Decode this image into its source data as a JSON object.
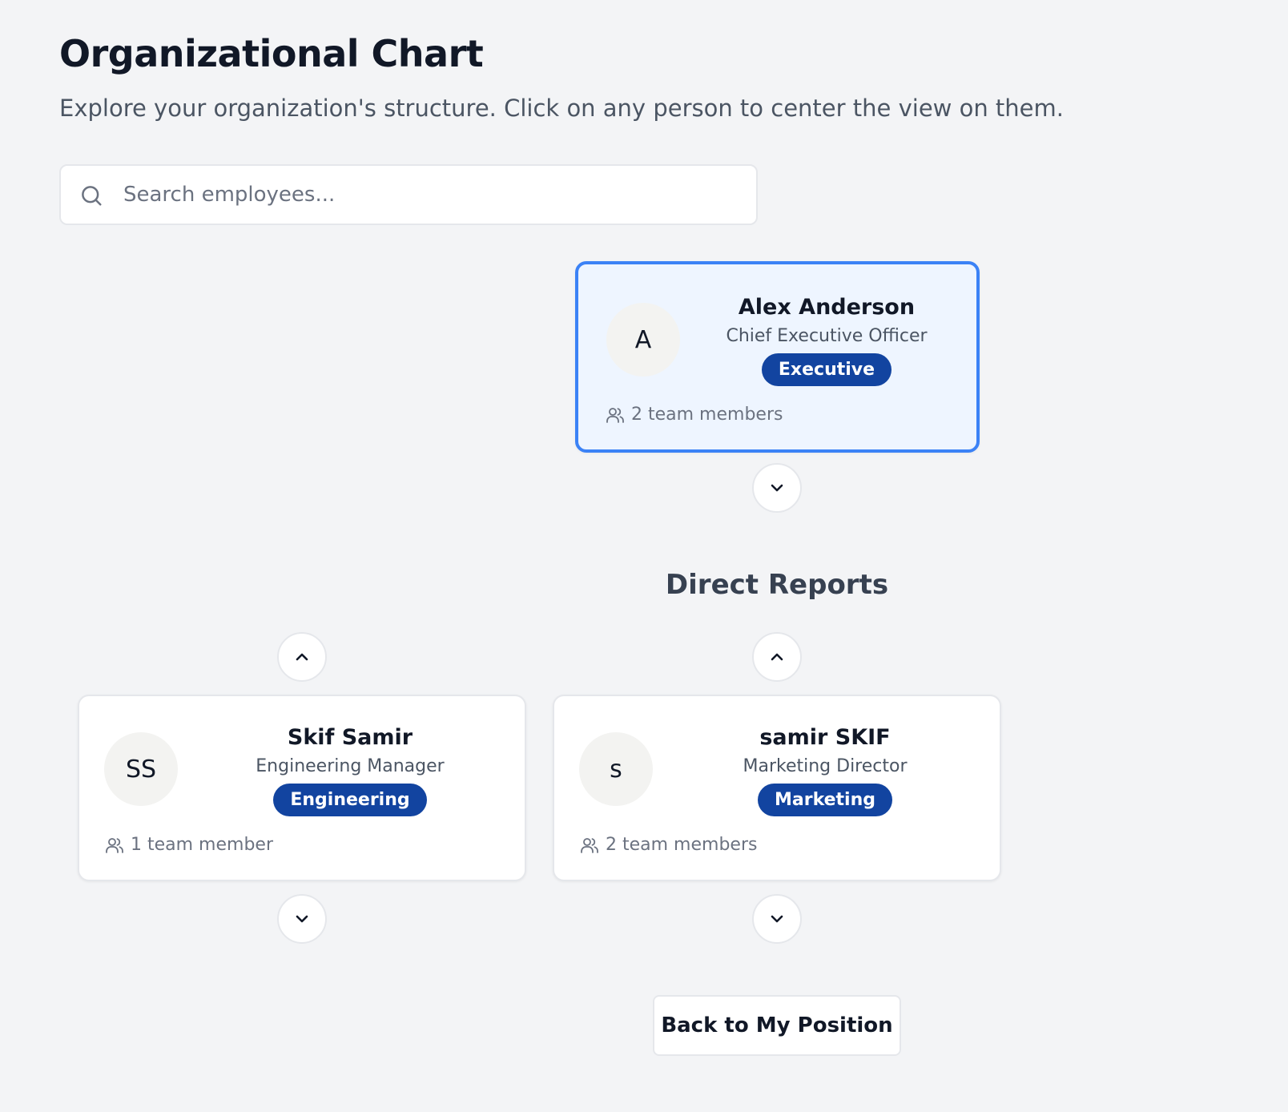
{
  "header": {
    "title": "Organizational Chart",
    "subtitle": "Explore your organization's structure. Click on any person to center the view on them."
  },
  "search": {
    "placeholder": "Search employees...",
    "value": ""
  },
  "focused_person": {
    "initials": "A",
    "name": "Alex Anderson",
    "title": "Chief Executive Officer",
    "department": "Executive",
    "team_count": "2 team members"
  },
  "direct_reports_heading": "Direct Reports",
  "direct_reports": [
    {
      "initials": "SS",
      "name": "Skif Samir",
      "title": "Engineering Manager",
      "department": "Engineering",
      "team_count": "1 team member"
    },
    {
      "initials": "s",
      "name": "samir SKIF",
      "title": "Marketing Director",
      "department": "Marketing",
      "team_count": "2 team members"
    }
  ],
  "actions": {
    "back_label": "Back to My Position"
  },
  "icons": {
    "search": "search-icon",
    "team": "users-icon",
    "expand": "chevron-down-icon",
    "collapse": "chevron-up-icon"
  },
  "colors": {
    "accent_border": "#3b82f6",
    "selected_bg": "#eef5ff",
    "badge_bg": "#1244a0",
    "page_bg": "#f3f4f6"
  }
}
